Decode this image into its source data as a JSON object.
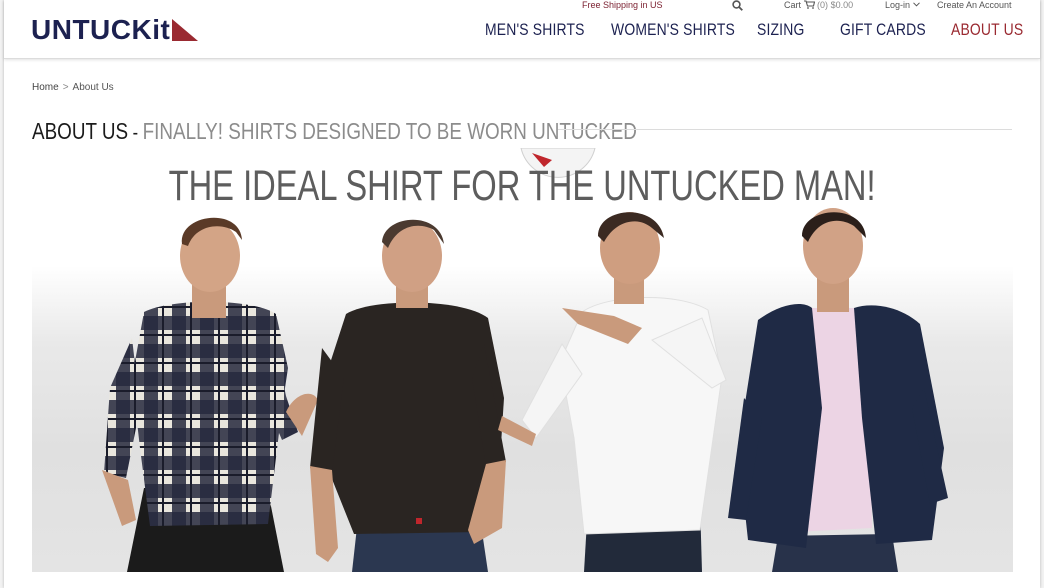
{
  "brand": {
    "logo_text": "UNTUCKit",
    "navy": "#1c2150",
    "red": "#9a2a31"
  },
  "utility_bar": {
    "shipping": "Free Shipping in US",
    "search_icon": "search-icon",
    "cart_label": "Cart",
    "cart_icon": "cart-icon",
    "cart_count": "(0)",
    "cart_total": "$0.00",
    "login": "Log-in",
    "create_account": "Create An Account"
  },
  "nav": {
    "items": [
      {
        "label": "MEN'S SHIRTS",
        "active": false
      },
      {
        "label": "WOMEN'S SHIRTS",
        "active": false
      },
      {
        "label": "SIZING",
        "active": false
      },
      {
        "label": "GIFT CARDS",
        "active": false
      },
      {
        "label": "ABOUT US",
        "active": true
      }
    ]
  },
  "breadcrumb": {
    "home": "Home",
    "separator": ">",
    "current": "About Us"
  },
  "page": {
    "title": "ABOUT US",
    "title_separator": " - ",
    "subtitle": "FINALLY! SHIRTS DESIGNED TO BE WORN UNTUCKED",
    "tagline": "THE IDEAL SHIRT FOR THE UNTUCKED MAN!"
  },
  "hero": {
    "models": [
      {
        "name": "model-plaid-shirt"
      },
      {
        "name": "model-black-shirt"
      },
      {
        "name": "model-white-shirt-ball"
      },
      {
        "name": "model-navy-blazer"
      }
    ]
  }
}
